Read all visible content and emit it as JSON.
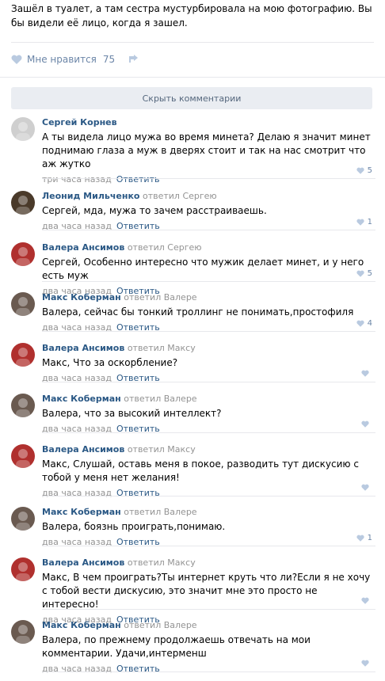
{
  "post": {
    "text": "Зашёл в туалет, а там сестра мустурбировала на мою фотографию. Вы бы видели её лицо, когда я зашел.",
    "like_label": "Мне нравится",
    "like_count": "75"
  },
  "hide_comments_label": "Скрыть комментарии",
  "reply_label": "Ответить",
  "comments": [
    {
      "author": "Сергей Корнев",
      "reply_to": "",
      "text": "А ты видела лицо мужа во время минета? Делаю я значит минет поднимаю глаза а муж в дверях стоит и так на нас смотрит что аж жутко",
      "time": "три часа назад",
      "likes": "5"
    },
    {
      "author": "Леонид Мильченко",
      "reply_to": "ответил Сергею",
      "text": "Сергей, мда, мужа то зачем расстраиваешь.",
      "time": "два часа назад",
      "likes": "1"
    },
    {
      "author": "Валера Ансимов",
      "reply_to": "ответил Сергею",
      "text": "Сергей, Особенно интересно что мужик делает минет, и у него есть муж",
      "time": "два часа назад",
      "likes": "5"
    },
    {
      "author": "Макс Коберман",
      "reply_to": "ответил Валере",
      "text": "Валера, сейчас бы тонкий троллинг не понимать,простофиля",
      "time": "два часа назад",
      "likes": "4"
    },
    {
      "author": "Валера Ансимов",
      "reply_to": "ответил Максу",
      "text": "Макс, Что за оскорбление?",
      "time": "два часа назад",
      "likes": ""
    },
    {
      "author": "Макс Коберман",
      "reply_to": "ответил Валере",
      "text": "Валера, что за высокий интеллект?",
      "time": "два часа назад",
      "likes": ""
    },
    {
      "author": "Валера Ансимов",
      "reply_to": "ответил Максу",
      "text": "Макс, Слушай, оставь меня в покое, разводить тут дискусию с тобой у меня нет желания!",
      "time": "два часа назад",
      "likes": ""
    },
    {
      "author": "Макс Коберман",
      "reply_to": "ответил Валере",
      "text": "Валера, боязнь проиграть,понимаю.",
      "time": "два часа назад",
      "likes": "1"
    },
    {
      "author": "Валера Ансимов",
      "reply_to": "ответил Максу",
      "text": "Макс, В чем проиграть?Ты интернет круть что ли?Если я не хочу с тобой вести дискусию, это значит мне это просто не интересно!",
      "time": "два часа назад",
      "likes": ""
    },
    {
      "author": "Макс Коберман",
      "reply_to": "ответил Валере",
      "text": "Валера, по прежнему продолжаешь отвечать на мои комментарии. Удачи,интерменш",
      "time": "два часа назад",
      "likes": ""
    }
  ],
  "colors": {
    "link": "#2a5885",
    "muted": "#939393",
    "like": "#6c86a8",
    "bar_bg": "#eaedf2"
  }
}
